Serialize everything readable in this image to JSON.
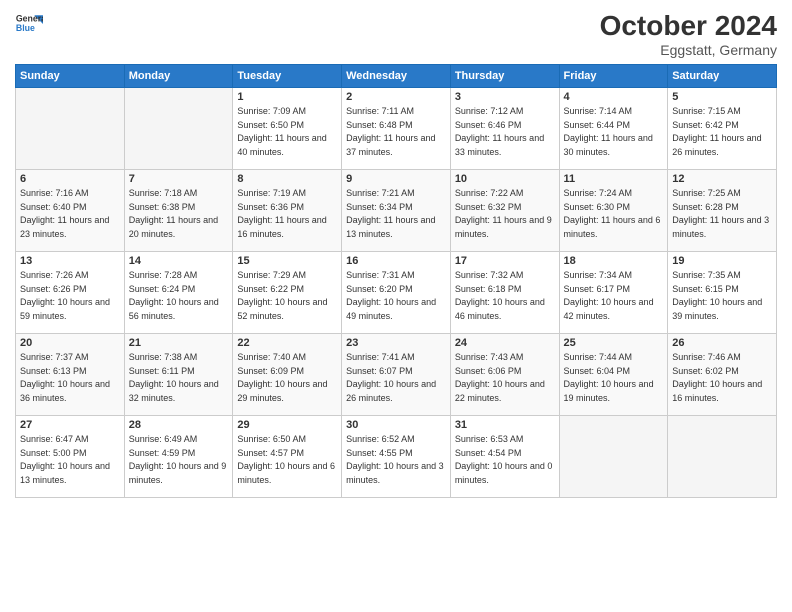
{
  "header": {
    "logo_line1": "General",
    "logo_line2": "Blue",
    "month": "October 2024",
    "location": "Eggstatt, Germany"
  },
  "days_of_week": [
    "Sunday",
    "Monday",
    "Tuesday",
    "Wednesday",
    "Thursday",
    "Friday",
    "Saturday"
  ],
  "weeks": [
    [
      {
        "day": "",
        "info": ""
      },
      {
        "day": "",
        "info": ""
      },
      {
        "day": "1",
        "info": "Sunrise: 7:09 AM\nSunset: 6:50 PM\nDaylight: 11 hours and 40 minutes."
      },
      {
        "day": "2",
        "info": "Sunrise: 7:11 AM\nSunset: 6:48 PM\nDaylight: 11 hours and 37 minutes."
      },
      {
        "day": "3",
        "info": "Sunrise: 7:12 AM\nSunset: 6:46 PM\nDaylight: 11 hours and 33 minutes."
      },
      {
        "day": "4",
        "info": "Sunrise: 7:14 AM\nSunset: 6:44 PM\nDaylight: 11 hours and 30 minutes."
      },
      {
        "day": "5",
        "info": "Sunrise: 7:15 AM\nSunset: 6:42 PM\nDaylight: 11 hours and 26 minutes."
      }
    ],
    [
      {
        "day": "6",
        "info": "Sunrise: 7:16 AM\nSunset: 6:40 PM\nDaylight: 11 hours and 23 minutes."
      },
      {
        "day": "7",
        "info": "Sunrise: 7:18 AM\nSunset: 6:38 PM\nDaylight: 11 hours and 20 minutes."
      },
      {
        "day": "8",
        "info": "Sunrise: 7:19 AM\nSunset: 6:36 PM\nDaylight: 11 hours and 16 minutes."
      },
      {
        "day": "9",
        "info": "Sunrise: 7:21 AM\nSunset: 6:34 PM\nDaylight: 11 hours and 13 minutes."
      },
      {
        "day": "10",
        "info": "Sunrise: 7:22 AM\nSunset: 6:32 PM\nDaylight: 11 hours and 9 minutes."
      },
      {
        "day": "11",
        "info": "Sunrise: 7:24 AM\nSunset: 6:30 PM\nDaylight: 11 hours and 6 minutes."
      },
      {
        "day": "12",
        "info": "Sunrise: 7:25 AM\nSunset: 6:28 PM\nDaylight: 11 hours and 3 minutes."
      }
    ],
    [
      {
        "day": "13",
        "info": "Sunrise: 7:26 AM\nSunset: 6:26 PM\nDaylight: 10 hours and 59 minutes."
      },
      {
        "day": "14",
        "info": "Sunrise: 7:28 AM\nSunset: 6:24 PM\nDaylight: 10 hours and 56 minutes."
      },
      {
        "day": "15",
        "info": "Sunrise: 7:29 AM\nSunset: 6:22 PM\nDaylight: 10 hours and 52 minutes."
      },
      {
        "day": "16",
        "info": "Sunrise: 7:31 AM\nSunset: 6:20 PM\nDaylight: 10 hours and 49 minutes."
      },
      {
        "day": "17",
        "info": "Sunrise: 7:32 AM\nSunset: 6:18 PM\nDaylight: 10 hours and 46 minutes."
      },
      {
        "day": "18",
        "info": "Sunrise: 7:34 AM\nSunset: 6:17 PM\nDaylight: 10 hours and 42 minutes."
      },
      {
        "day": "19",
        "info": "Sunrise: 7:35 AM\nSunset: 6:15 PM\nDaylight: 10 hours and 39 minutes."
      }
    ],
    [
      {
        "day": "20",
        "info": "Sunrise: 7:37 AM\nSunset: 6:13 PM\nDaylight: 10 hours and 36 minutes."
      },
      {
        "day": "21",
        "info": "Sunrise: 7:38 AM\nSunset: 6:11 PM\nDaylight: 10 hours and 32 minutes."
      },
      {
        "day": "22",
        "info": "Sunrise: 7:40 AM\nSunset: 6:09 PM\nDaylight: 10 hours and 29 minutes."
      },
      {
        "day": "23",
        "info": "Sunrise: 7:41 AM\nSunset: 6:07 PM\nDaylight: 10 hours and 26 minutes."
      },
      {
        "day": "24",
        "info": "Sunrise: 7:43 AM\nSunset: 6:06 PM\nDaylight: 10 hours and 22 minutes."
      },
      {
        "day": "25",
        "info": "Sunrise: 7:44 AM\nSunset: 6:04 PM\nDaylight: 10 hours and 19 minutes."
      },
      {
        "day": "26",
        "info": "Sunrise: 7:46 AM\nSunset: 6:02 PM\nDaylight: 10 hours and 16 minutes."
      }
    ],
    [
      {
        "day": "27",
        "info": "Sunrise: 6:47 AM\nSunset: 5:00 PM\nDaylight: 10 hours and 13 minutes."
      },
      {
        "day": "28",
        "info": "Sunrise: 6:49 AM\nSunset: 4:59 PM\nDaylight: 10 hours and 9 minutes."
      },
      {
        "day": "29",
        "info": "Sunrise: 6:50 AM\nSunset: 4:57 PM\nDaylight: 10 hours and 6 minutes."
      },
      {
        "day": "30",
        "info": "Sunrise: 6:52 AM\nSunset: 4:55 PM\nDaylight: 10 hours and 3 minutes."
      },
      {
        "day": "31",
        "info": "Sunrise: 6:53 AM\nSunset: 4:54 PM\nDaylight: 10 hours and 0 minutes."
      },
      {
        "day": "",
        "info": ""
      },
      {
        "day": "",
        "info": ""
      }
    ]
  ]
}
